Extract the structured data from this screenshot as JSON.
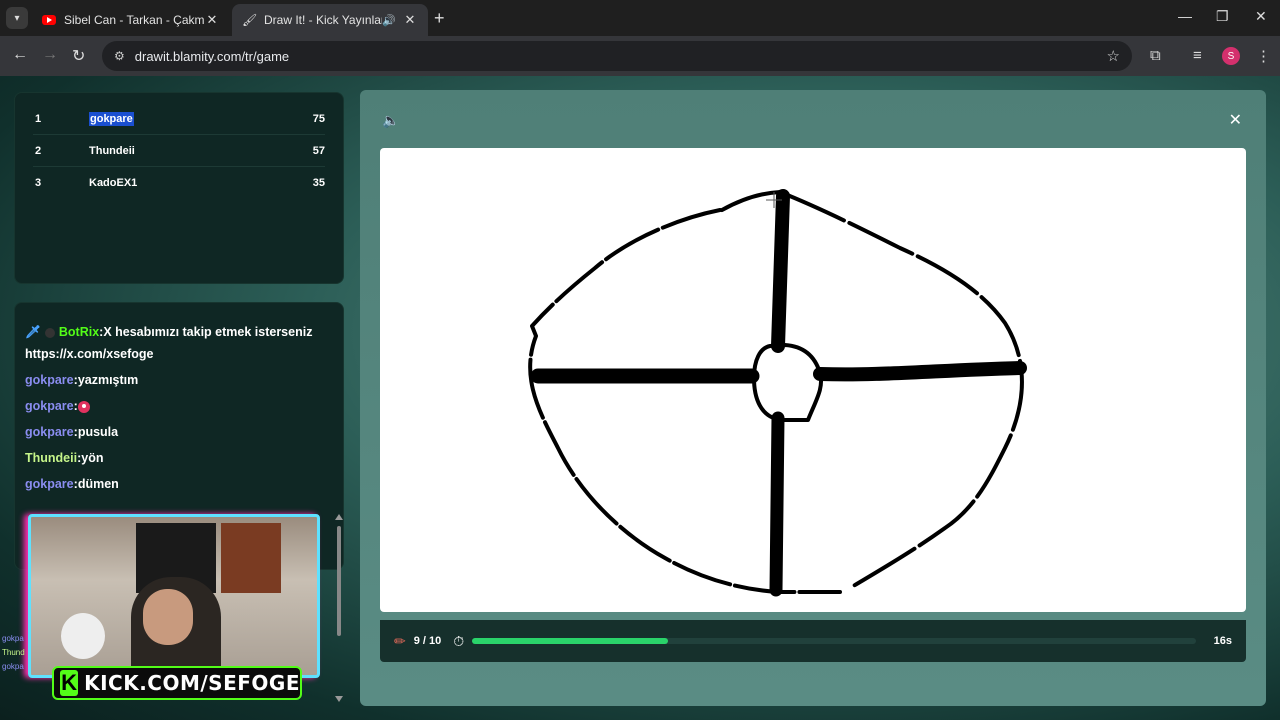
{
  "browser": {
    "tabs": [
      {
        "title": "Sibel Can - Tarkan - Çakmak Ça",
        "active": false,
        "favicon": "youtube-icon"
      },
      {
        "title": "Draw It! - Kick Yayınları İçin",
        "active": true,
        "favicon": "drawit-icon",
        "audio": true
      }
    ],
    "url": "drawit.blamity.com/tr/game",
    "profile_initial": "S"
  },
  "leaderboard": [
    {
      "rank": "1",
      "name": "gokpare",
      "score": "75"
    },
    {
      "rank": "2",
      "name": "Thundeii",
      "score": "57"
    },
    {
      "rank": "3",
      "name": "KadoEX1",
      "score": "35"
    }
  ],
  "chat": [
    {
      "user": "BotRix",
      "text": "X hesabımızı takip etmek isterseniz https://x.com/xsefoge",
      "style": "botrix"
    },
    {
      "user": "gokpare",
      "text": "yazmıştım",
      "style": "purple"
    },
    {
      "user": "gokpare",
      "text": "",
      "style": "purple",
      "emote": "heart"
    },
    {
      "user": "gokpare",
      "text": "pusula",
      "style": "purple"
    },
    {
      "user": "Thundeii",
      "text": "yön",
      "style": "green"
    },
    {
      "user": "gokpare",
      "text": "dümen",
      "style": "purple"
    }
  ],
  "overlay": {
    "kick_text": "KICK.COM/SEFOGE",
    "ghost_chat": [
      "gokpa",
      "Thund",
      "gokpa"
    ]
  },
  "game": {
    "round": "9 / 10",
    "time_left": "16s",
    "progress_fraction": 0.27,
    "progress_color": "#2ad36a"
  }
}
